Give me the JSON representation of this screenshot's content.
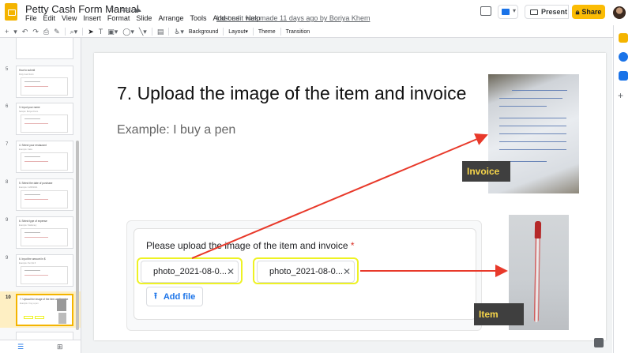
{
  "app": {
    "doc_title": "Petty Cash Form Manual",
    "menu": [
      "File",
      "Edit",
      "View",
      "Insert",
      "Format",
      "Slide",
      "Arrange",
      "Tools",
      "Add-ons",
      "Help"
    ],
    "last_edit": "Last edit was made 11 days ago by Boriya Khem",
    "present_label": "Present",
    "share_label": "Share"
  },
  "toolbar": {
    "background_label": "Background",
    "layout_label": "Layout",
    "theme_label": "Theme",
    "transition_label": "Transition"
  },
  "filmstrip": {
    "slides": [
      {
        "num": "4",
        "title": "",
        "sub": ""
      },
      {
        "num": "5",
        "title": "How to submit",
        "sub": "Petty Cash Form"
      },
      {
        "num": "6",
        "title": "3. Input your name",
        "sub": "Sample: Boriya Khem"
      },
      {
        "num": "7",
        "title": "4. Select your restaurant",
        "sub": "Example: Kaka"
      },
      {
        "num": "8",
        "title": "5. Select the date of purchase",
        "sub": "Example: 11/08/2021"
      },
      {
        "num": "9",
        "title": "6. Select type of expense",
        "sub": "Example: Stationary"
      },
      {
        "num": "9",
        "title": "6. Input the amount in $",
        "sub": "Example: Pen $1.5"
      },
      {
        "num": "10",
        "title": "7. Upload the image of the item and invoice",
        "sub": "Example: I buy a pen"
      }
    ]
  },
  "slide": {
    "title": "7. Upload the image of the item and invoice",
    "subtitle": "Example: I buy a pen",
    "form_question": "Please upload the image of the item and invoice",
    "required_mark": "*",
    "files": [
      "photo_2021-08-0...",
      "photo_2021-08-0..."
    ],
    "add_file_label": "Add file",
    "invoice_label": "Invoice",
    "item_label": "Item"
  },
  "colors": {
    "highlight": "#eef224",
    "arrow": "#e8392a",
    "label_bg": "#3f3f3f",
    "label_text": "#f6d54a",
    "accent": "#1a73e8",
    "share": "#fbbc04"
  }
}
